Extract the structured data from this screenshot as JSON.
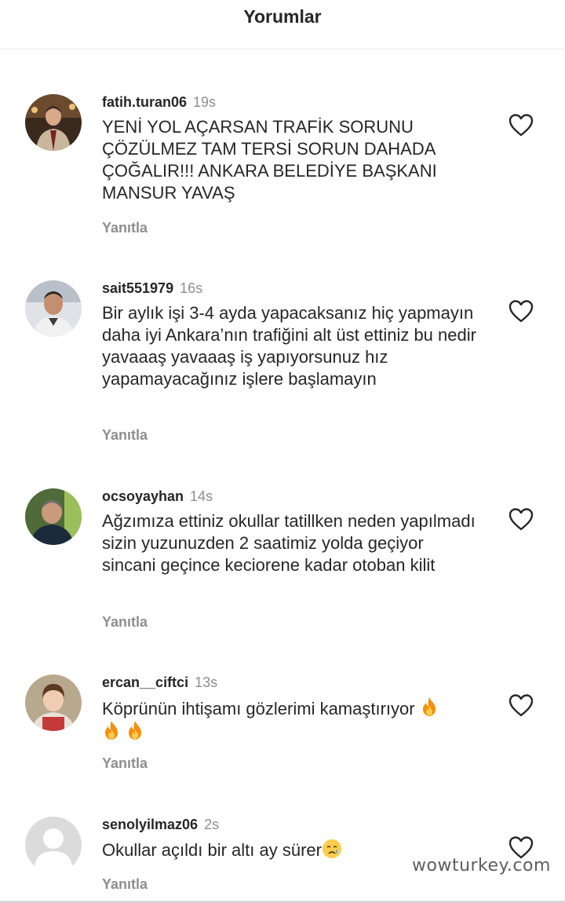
{
  "header": {
    "title": "Yorumlar"
  },
  "comments": [
    {
      "username": "fatih.turan06",
      "time": "19s",
      "text": "YENİ YOL AÇARSAN TRAFİK SORUNU ÇÖZÜLMEZ TAM TERSİ SORUN DAHADA ÇOĞALIR!!! ANKARA BELEDİYE BAŞKANI MANSUR YAVAŞ",
      "reply_label": "Yanıtla"
    },
    {
      "username": "sait551979",
      "time": "16s",
      "text": "Bir aylık işi 3-4 ayda yapacaksanız hiç yapmayın daha iyi Ankara’nın trafiğini alt üst ettiniz bu nedir yavaaaş yavaaaş iş yapıyorsunuz hız yapamayacağınız işlere başlamayın",
      "reply_label": "Yanıtla"
    },
    {
      "username": "ocsoyayhan",
      "time": "14s",
      "text": "Ağzımıza ettiniz okullar tatillken neden yapılmadı sizin yuzunuzden 2 saatimiz yolda geçiyor sincani geçince keciorene kadar otoban kilit",
      "reply_label": "Yanıtla"
    },
    {
      "username": "ercan__ciftci",
      "time": "13s",
      "text": "Köprünün ihtişamı gözlerimi kamaştırıyor",
      "emoji": "fire-emoji",
      "reply_label": "Yanıtla"
    },
    {
      "username": "senolyilmaz06",
      "time": "2s",
      "text": "Okullar açıldı bir altı ay sürer",
      "emoji": "crying-face-emoji",
      "reply_label": "Yanıtla"
    }
  ],
  "icons": {
    "like": "heart-outline-icon",
    "default_avatar": "user-silhouette-icon"
  },
  "watermark": "wowturkey.com",
  "colors": {
    "text": "#262626",
    "muted": "#8e8e8e",
    "divider": "#e6e6e6"
  }
}
